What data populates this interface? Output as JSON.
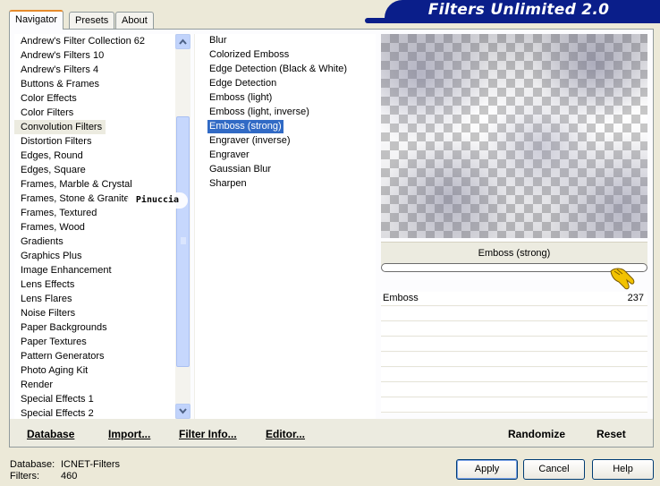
{
  "tabs": [
    "Navigator",
    "Presets",
    "About"
  ],
  "banner_title": "Filters Unlimited 2.0",
  "categories": [
    "Andrew's Filter Collection 62",
    "Andrew's Filters 10",
    "Andrew's Filters 4",
    "Buttons & Frames",
    "Color Effects",
    "Color Filters",
    "Convolution Filters",
    "Distortion Filters",
    "Edges, Round",
    "Edges, Square",
    "Frames, Marble & Crystal",
    "Frames, Stone & Granite",
    "Frames, Textured",
    "Frames, Wood",
    "Gradients",
    "Graphics Plus",
    "Image Enhancement",
    "Lens Effects",
    "Lens Flares",
    "Noise Filters",
    "Paper Backgrounds",
    "Paper Textures",
    "Pattern Generators",
    "Photo Aging Kit",
    "Render",
    "Special Effects 1",
    "Special Effects 2"
  ],
  "selected_category": "Convolution Filters",
  "filters": [
    "Blur",
    "Colorized Emboss",
    "Edge Detection (Black & White)",
    "Edge Detection",
    "Emboss (light)",
    "Emboss (light, inverse)",
    "Emboss (strong)",
    "Engraver (inverse)",
    "Engraver",
    "Gaussian Blur",
    "Sharpen"
  ],
  "selected_filter": "Emboss (strong)",
  "preview_filter_name": "Emboss (strong)",
  "parameter": {
    "label": "Emboss",
    "value": "237",
    "fraction": 0.93
  },
  "bottom_buttons": {
    "database": "Database",
    "import": "Import...",
    "filter_info": "Filter Info...",
    "editor": "Editor...",
    "randomize": "Randomize",
    "reset": "Reset"
  },
  "info": {
    "database_label": "Database:",
    "database_value": "ICNET-Filters",
    "filters_label": "Filters:",
    "filters_value": "460"
  },
  "dialog_buttons": {
    "apply": "Apply",
    "cancel": "Cancel",
    "help": "Help"
  },
  "watermark": "Pinuccia",
  "icons": [
    "scroll-up-icon",
    "scroll-down-icon",
    "pointing-hand-icon"
  ]
}
